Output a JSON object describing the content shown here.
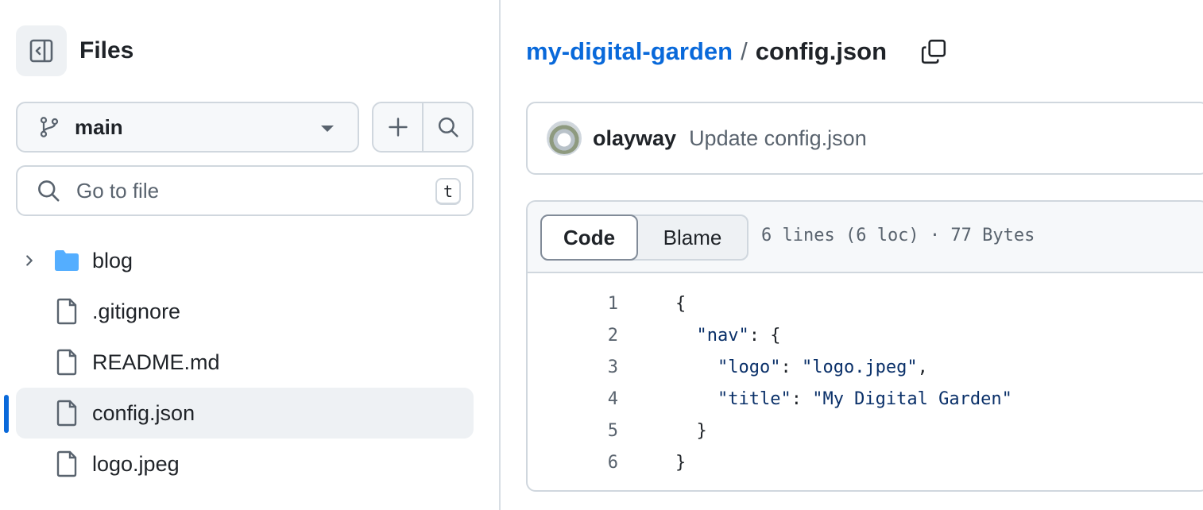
{
  "sidebar": {
    "title": "Files",
    "branch": "main",
    "goto_placeholder": "Go to file",
    "goto_shortcut": "t",
    "tree": [
      {
        "name": "blog",
        "type": "folder"
      },
      {
        "name": ".gitignore",
        "type": "file"
      },
      {
        "name": "README.md",
        "type": "file"
      },
      {
        "name": "config.json",
        "type": "file",
        "selected": true
      },
      {
        "name": "logo.jpeg",
        "type": "file"
      }
    ]
  },
  "breadcrumb": {
    "repo": "my-digital-garden",
    "separator": "/",
    "file": "config.json"
  },
  "commit": {
    "author": "olayway",
    "message": "Update config.json"
  },
  "file_view": {
    "tabs": [
      "Code",
      "Blame"
    ],
    "active_tab": "Code",
    "meta": "6 lines (6 loc) · 77 Bytes",
    "lines": [
      {
        "n": "1"
      },
      {
        "n": "2",
        "key": "\"nav\""
      },
      {
        "n": "3",
        "key": "\"logo\"",
        "value": "\"logo.jpeg\""
      },
      {
        "n": "4",
        "key": "\"title\"",
        "value": "\"My Digital Garden\""
      },
      {
        "n": "5"
      },
      {
        "n": "6"
      }
    ]
  },
  "colors": {
    "accent": "#0969da",
    "border": "#d0d7de",
    "muted_text": "#59636e",
    "selected_bg": "#eef1f4",
    "folder": "#54aeff"
  },
  "icons": {
    "sidebar_toggle": "sidebar-collapse-icon",
    "branch": "git-branch-icon",
    "add": "plus-icon",
    "search": "search-icon",
    "copy": "copy-icon",
    "folder": "folder-icon",
    "file": "file-icon",
    "chevron": "chevron-right-icon"
  }
}
